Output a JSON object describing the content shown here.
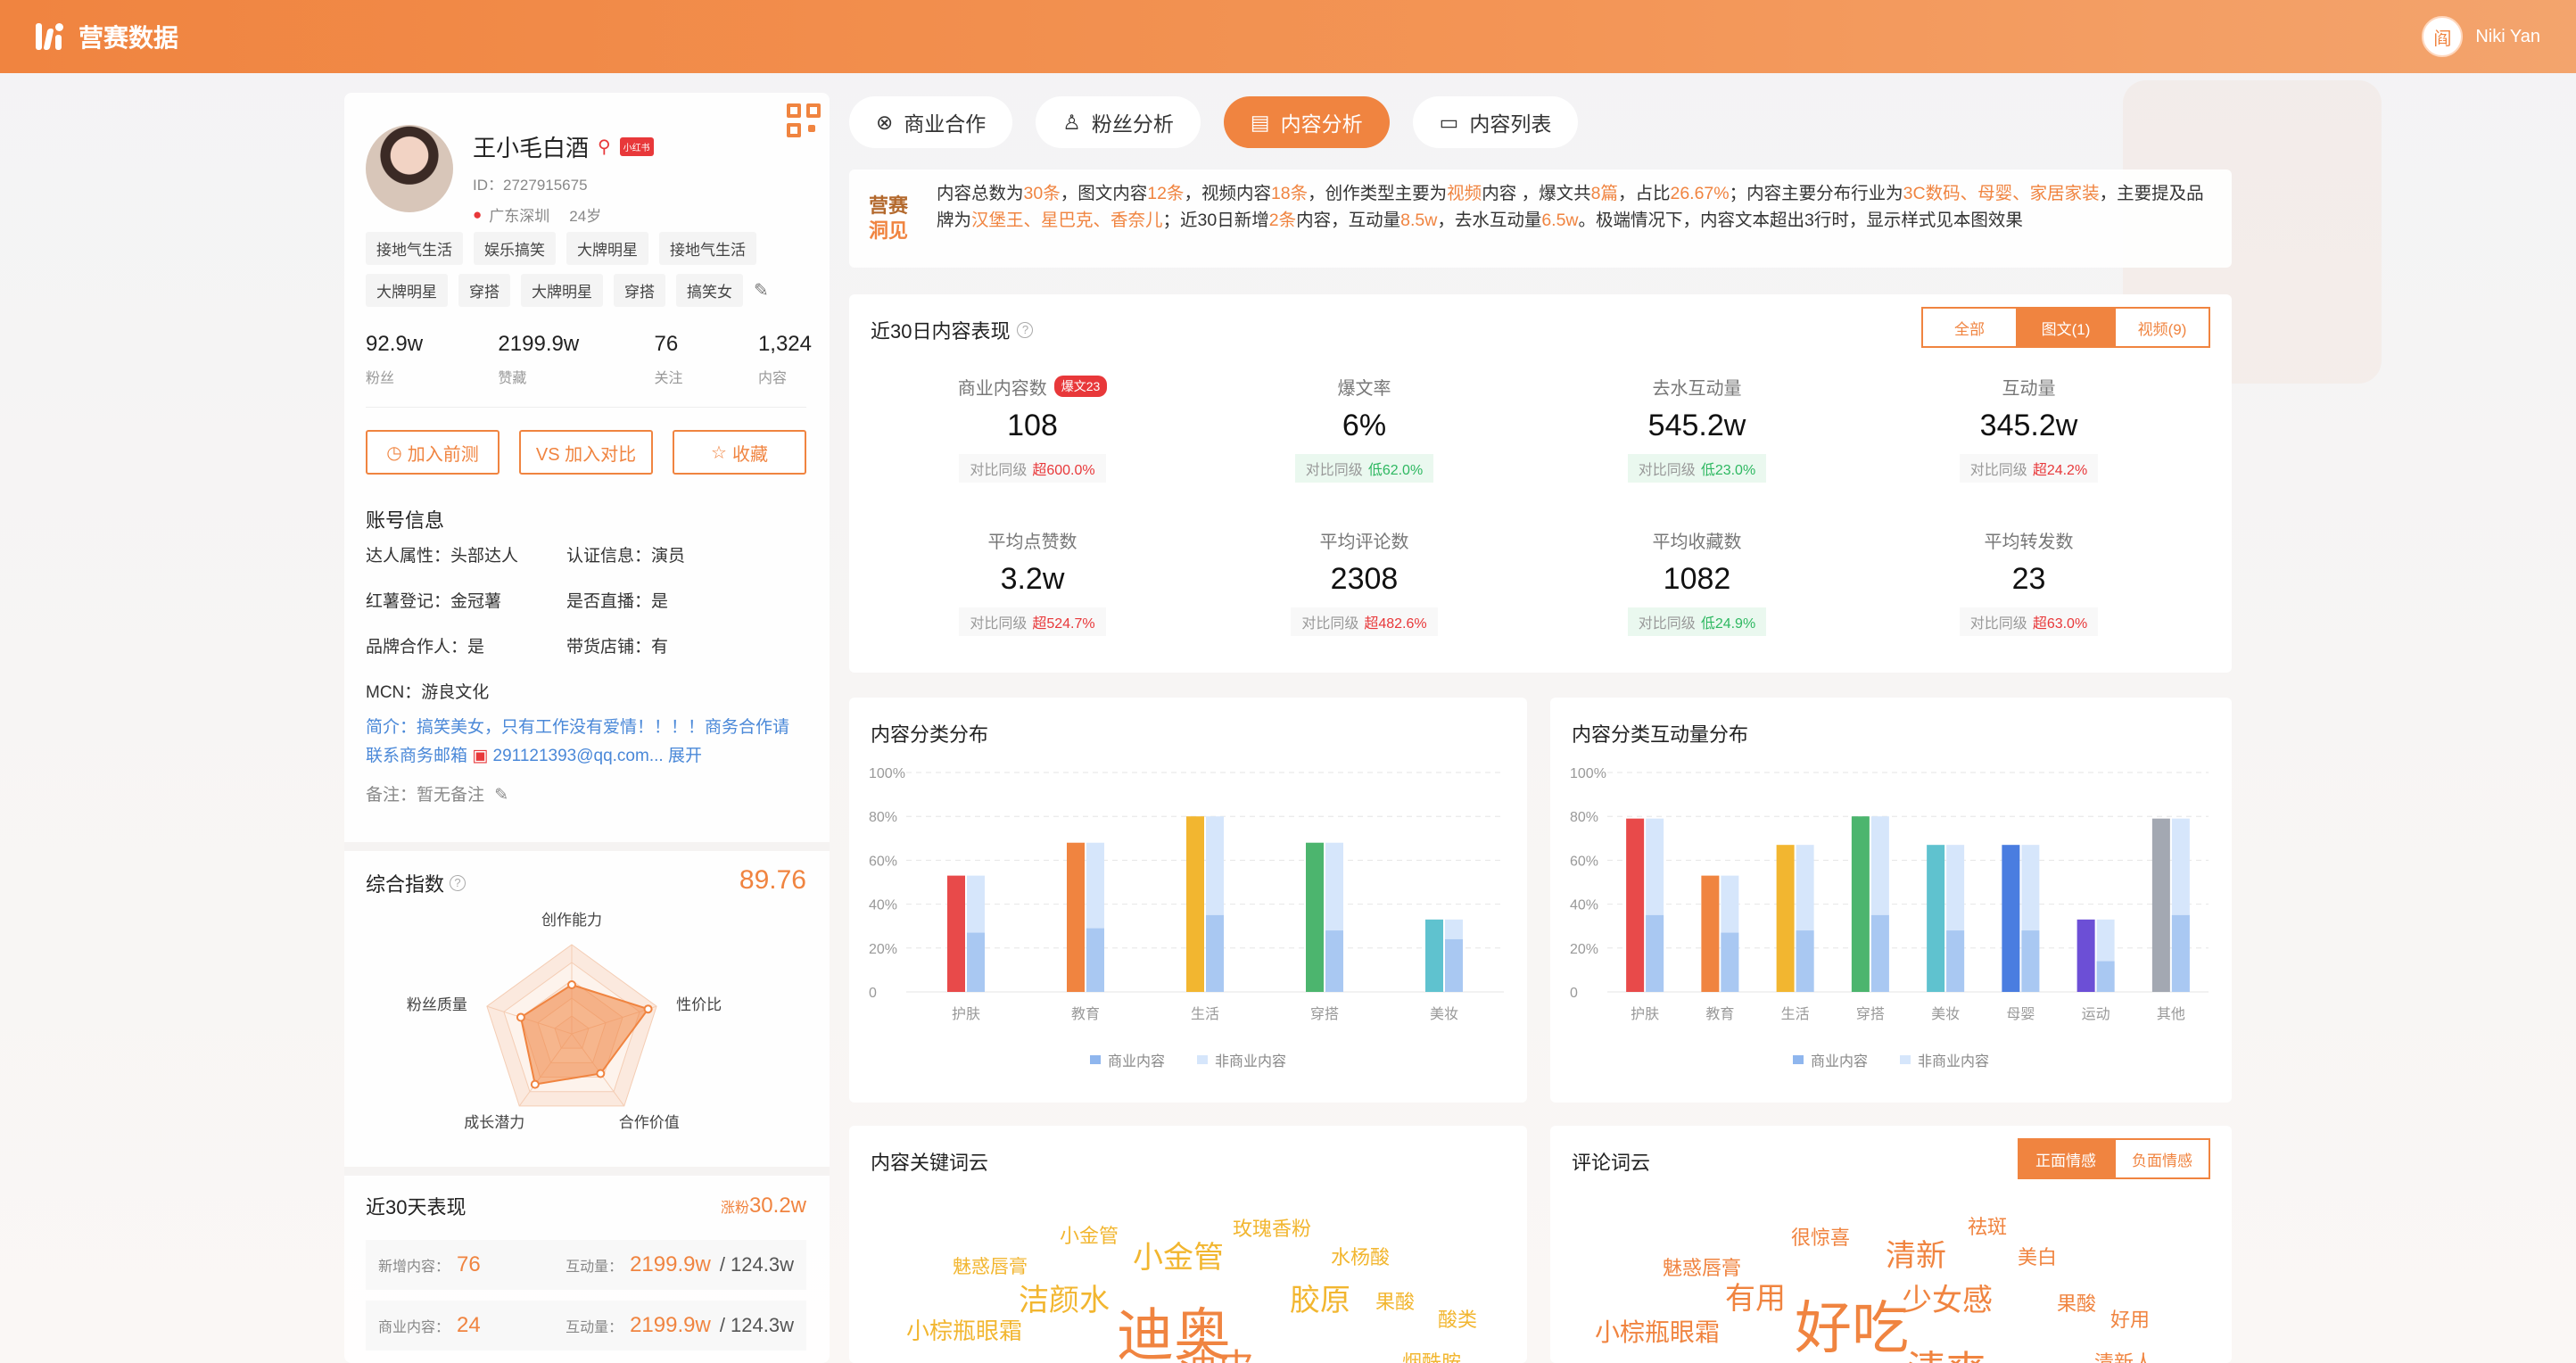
{
  "header": {
    "brand": "营赛数据",
    "user_avatar_char": "阎",
    "user_name": "Niki Yan"
  },
  "profile": {
    "name": "王小毛白酒",
    "platform_badge": "小红书",
    "id": "ID：2727915675",
    "location": "广东深圳",
    "age": "24岁",
    "tags": [
      "接地气生活",
      "娱乐搞笑",
      "大牌明星",
      "接地气生活",
      "大牌明星",
      "穿搭",
      "大牌明星",
      "穿搭",
      "搞笑女"
    ],
    "stats": [
      {
        "value": "92.9w",
        "label": "粉丝"
      },
      {
        "value": "2199.9w",
        "label": "赞藏"
      },
      {
        "value": "76",
        "label": "关注"
      },
      {
        "value": "1,324",
        "label": "内容"
      }
    ],
    "actions": {
      "add_test": "加入前测",
      "vs": "VS 加入对比",
      "favorite": "收藏"
    }
  },
  "account": {
    "title": "账号信息",
    "items": [
      "达人属性：头部达人",
      "认证信息：演员",
      "红薯登记：金冠薯",
      "是否直播：是",
      "品牌合作人：是",
      "带货店铺：有",
      "MCN：游良文化"
    ],
    "bio_prefix": "简介：搞笑美女，只有工作没有爱情！！！！商务合作请联系商务邮箱",
    "bio_mail": "291121393@qq.com...",
    "bio_more": "展开",
    "remark": "备注：暂无备注"
  },
  "score": {
    "title": "综合指数",
    "value": "89.76",
    "axes": [
      "创作能力",
      "性价比",
      "合作价值",
      "成长潜力",
      "粉丝质量"
    ],
    "levels": [
      0.55,
      0.9,
      0.55,
      0.7,
      0.6
    ]
  },
  "recent30": {
    "title": "近30天表现",
    "growth_label": "涨粉",
    "growth_value": "30.2w",
    "rows": [
      {
        "label": "新增内容：",
        "value": "76",
        "inter_label": "互动量：",
        "inter_value": "2199.9w",
        "total": "/ 124.3w"
      },
      {
        "label": "商业内容：",
        "value": "24",
        "inter_label": "互动量：",
        "inter_value": "2199.9w",
        "total": "/ 124.3w"
      }
    ]
  },
  "tabs": [
    "商业合作",
    "粉丝分析",
    "内容分析",
    "内容列表"
  ],
  "insight": {
    "badge_line1": "营赛",
    "badge_line2": "洞见",
    "segments": [
      {
        "t": "内容总数为",
        "h": false
      },
      {
        "t": "30条",
        "h": true
      },
      {
        "t": "，图文内容",
        "h": false
      },
      {
        "t": "12条",
        "h": true
      },
      {
        "t": "，视频内容",
        "h": false
      },
      {
        "t": "18条",
        "h": true
      },
      {
        "t": "，创作类型主要为",
        "h": false
      },
      {
        "t": "视频",
        "h": true
      },
      {
        "t": "内容 ，爆文共",
        "h": false
      },
      {
        "t": "8篇",
        "h": true
      },
      {
        "t": "，占比",
        "h": false
      },
      {
        "t": "26.67%",
        "h": true
      },
      {
        "t": "；内容主要分布行业为",
        "h": false
      },
      {
        "t": "3C数码、母婴、家居家装",
        "h": true
      },
      {
        "t": "，主要提及品牌为",
        "h": false
      },
      {
        "t": "汉堡王、星巴克、香奈儿",
        "h": true
      },
      {
        "t": "；近30日新增",
        "h": false
      },
      {
        "t": "2条",
        "h": true
      },
      {
        "t": "内容，互动量",
        "h": false
      },
      {
        "t": "8.5w",
        "h": true
      },
      {
        "t": "，去水互动量",
        "h": false
      },
      {
        "t": "6.5w",
        "h": true
      },
      {
        "t": "。极端情况下，内容文本超出3行时，显示样式见本图效果",
        "h": false
      }
    ]
  },
  "performance": {
    "title": "近30日内容表现",
    "segments": [
      "全部",
      "图文(1)",
      "视频(9)"
    ],
    "metrics": [
      {
        "label": "商业内容数",
        "badge": "爆文23",
        "value": "108",
        "cmp_label": "对比同级",
        "cmp": "超600.0%",
        "dir": "up"
      },
      {
        "label": "爆文率",
        "badge": "",
        "value": "6%",
        "cmp_label": "对比同级",
        "cmp": "低62.0%",
        "dir": "down"
      },
      {
        "label": "去水互动量",
        "badge": "",
        "value": "545.2w",
        "cmp_label": "对比同级",
        "cmp": "低23.0%",
        "dir": "down"
      },
      {
        "label": "互动量",
        "badge": "",
        "value": "345.2w",
        "cmp_label": "对比同级",
        "cmp": "超24.2%",
        "dir": "up"
      },
      {
        "label": "平均点赞数",
        "badge": "",
        "value": "3.2w",
        "cmp_label": "对比同级",
        "cmp": "超524.7%",
        "dir": "up"
      },
      {
        "label": "平均评论数",
        "badge": "",
        "value": "2308",
        "cmp_label": "对比同级",
        "cmp": "超482.6%",
        "dir": "up"
      },
      {
        "label": "平均收藏数",
        "badge": "",
        "value": "1082",
        "cmp_label": "对比同级",
        "cmp": "低24.9%",
        "dir": "down"
      },
      {
        "label": "平均转发数",
        "badge": "",
        "value": "23",
        "cmp_label": "对比同级",
        "cmp": "超63.0%",
        "dir": "up"
      }
    ]
  },
  "chart_data": [
    {
      "type": "bar",
      "title": "内容分类分布",
      "categories": [
        "护肤",
        "教育",
        "生活",
        "穿搭",
        "美妆"
      ],
      "y_ticks": [
        "0",
        "20%",
        "40%",
        "60%",
        "80%",
        "100%"
      ],
      "ylim": [
        0,
        100
      ],
      "series": [
        {
          "name": "商业内容",
          "values": [
            53,
            68,
            80,
            68,
            33
          ]
        },
        {
          "name": "非商业内容",
          "values": [
            53,
            68,
            80,
            68,
            33
          ]
        }
      ],
      "inner_light": [
        27,
        29,
        35,
        28,
        24
      ],
      "colors": [
        "#e84a4a",
        "#f08440",
        "#f2b630",
        "#4cb56e",
        "#5fc2cf"
      ],
      "legend_position": "bottom"
    },
    {
      "type": "bar",
      "title": "内容分类互动量分布",
      "categories": [
        "护肤",
        "教育",
        "生活",
        "穿搭",
        "美妆",
        "母婴",
        "运动",
        "其他"
      ],
      "y_ticks": [
        "0",
        "20%",
        "40%",
        "60%",
        "80%",
        "100%"
      ],
      "ylim": [
        0,
        100
      ],
      "series": [
        {
          "name": "商业内容",
          "values": [
            79,
            53,
            67,
            80,
            67,
            67,
            33,
            79
          ]
        },
        {
          "name": "非商业内容",
          "values": [
            79,
            53,
            67,
            80,
            67,
            67,
            33,
            79
          ]
        }
      ],
      "inner_light": [
        35,
        27,
        28,
        35,
        28,
        28,
        14,
        35
      ],
      "colors": [
        "#e84a4a",
        "#f08440",
        "#f2b630",
        "#4cb56e",
        "#5fc2cf",
        "#4a7de0",
        "#6c4fd6",
        "#a3a8b2"
      ],
      "legend_position": "bottom"
    }
  ],
  "legend_colors": {
    "commercial": "#8fb6ee",
    "noncommercial": "#d6e6fb"
  },
  "cloud1": {
    "title": "内容关键词云",
    "words": [
      {
        "t": "小金管",
        "s": 22,
        "c": "#f2b630"
      },
      {
        "t": "玫瑰香粉",
        "s": 22,
        "c": "#f2b630"
      },
      {
        "t": "魅惑唇膏",
        "s": 21,
        "c": "#f2b630"
      },
      {
        "t": "小金管",
        "s": 34,
        "c": "#f2b630"
      },
      {
        "t": "水杨酸",
        "s": 22,
        "c": "#f2b630"
      },
      {
        "t": "洁颜水",
        "s": 34,
        "c": "#f2b630"
      },
      {
        "t": "胶原",
        "s": 34,
        "c": "#f2b630"
      },
      {
        "t": "果酸",
        "s": 22,
        "c": "#f2b630"
      },
      {
        "t": "小棕瓶眼霜",
        "s": 26,
        "c": "#f2b630"
      },
      {
        "t": "迪奥",
        "s": 64,
        "c": "#f08440"
      },
      {
        "t": "酸类",
        "s": 22,
        "c": "#f2b630"
      },
      {
        "t": "油皮",
        "s": 42,
        "c": "#f08440"
      },
      {
        "t": "烟酰胺",
        "s": 22,
        "c": "#f2b630"
      }
    ]
  },
  "cloud2": {
    "title": "评论词云",
    "segments": [
      "正面情感",
      "负面情感"
    ],
    "words": [
      {
        "t": "祛斑",
        "s": 22,
        "c": "#f08440"
      },
      {
        "t": "很惊喜",
        "s": 22,
        "c": "#f08440"
      },
      {
        "t": "清新",
        "s": 34,
        "c": "#f08440"
      },
      {
        "t": "美白",
        "s": 22,
        "c": "#f08440"
      },
      {
        "t": "魅惑唇膏",
        "s": 22,
        "c": "#f08440"
      },
      {
        "t": "有用",
        "s": 34,
        "c": "#f08440"
      },
      {
        "t": "少女感",
        "s": 34,
        "c": "#f08440"
      },
      {
        "t": "果酸",
        "s": 22,
        "c": "#f08440"
      },
      {
        "t": "好用",
        "s": 22,
        "c": "#f08440"
      },
      {
        "t": "小棕瓶眼霜",
        "s": 28,
        "c": "#f08440"
      },
      {
        "t": "好吃",
        "s": 64,
        "c": "#f08440"
      },
      {
        "t": "清爽",
        "s": 44,
        "c": "#f08440"
      },
      {
        "t": "清新人",
        "s": 22,
        "c": "#f08440"
      }
    ]
  }
}
